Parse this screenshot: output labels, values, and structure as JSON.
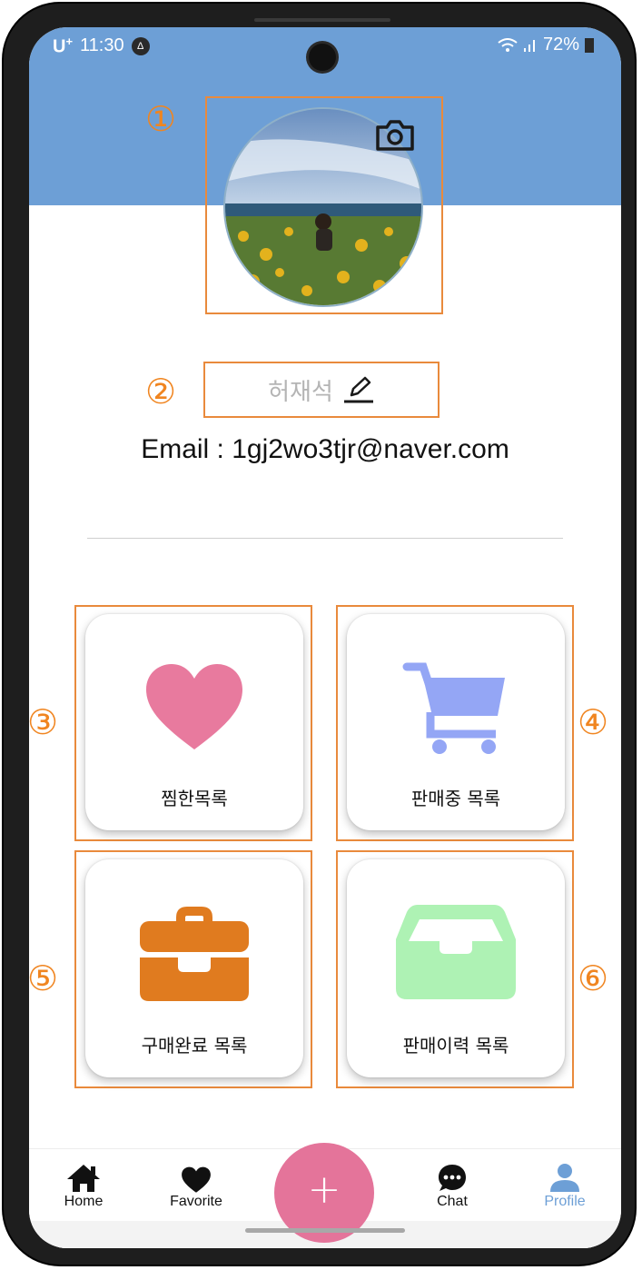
{
  "status_bar": {
    "carrier": "U",
    "carrier_sup": "+",
    "time": "11:30",
    "badge": "Δ",
    "battery": "72%",
    "signal": "ᐨ .ıl"
  },
  "profile": {
    "name": "허재석",
    "email_line": "Email : 1gj2wo3tjr@naver.com"
  },
  "annotations": [
    "①",
    "②",
    "③",
    "④",
    "⑤",
    "⑥"
  ],
  "cards": [
    {
      "label": "찜한목록",
      "icon": "heart-icon",
      "color": "#e87a9e"
    },
    {
      "label": "판매중 목록",
      "icon": "cart-icon",
      "color": "#94a6f5"
    },
    {
      "label": "구매완료 목록",
      "icon": "briefcase-icon",
      "color": "#e07b1f"
    },
    {
      "label": "판매이력 목록",
      "icon": "inbox-tray-icon",
      "color": "#aef2b4"
    }
  ],
  "tabs": [
    {
      "label": "Home",
      "icon": "home-icon"
    },
    {
      "label": "Favorite",
      "icon": "heart-icon"
    },
    {
      "label": "Chat",
      "icon": "chat-bubble-icon"
    },
    {
      "label": "Profile",
      "icon": "person-icon"
    }
  ],
  "fab_label": "+",
  "colors": {
    "header": "#6d9fd6",
    "annotation": "#f08520",
    "fab": "#e4749a",
    "active_tab": "#6d9fd6"
  }
}
